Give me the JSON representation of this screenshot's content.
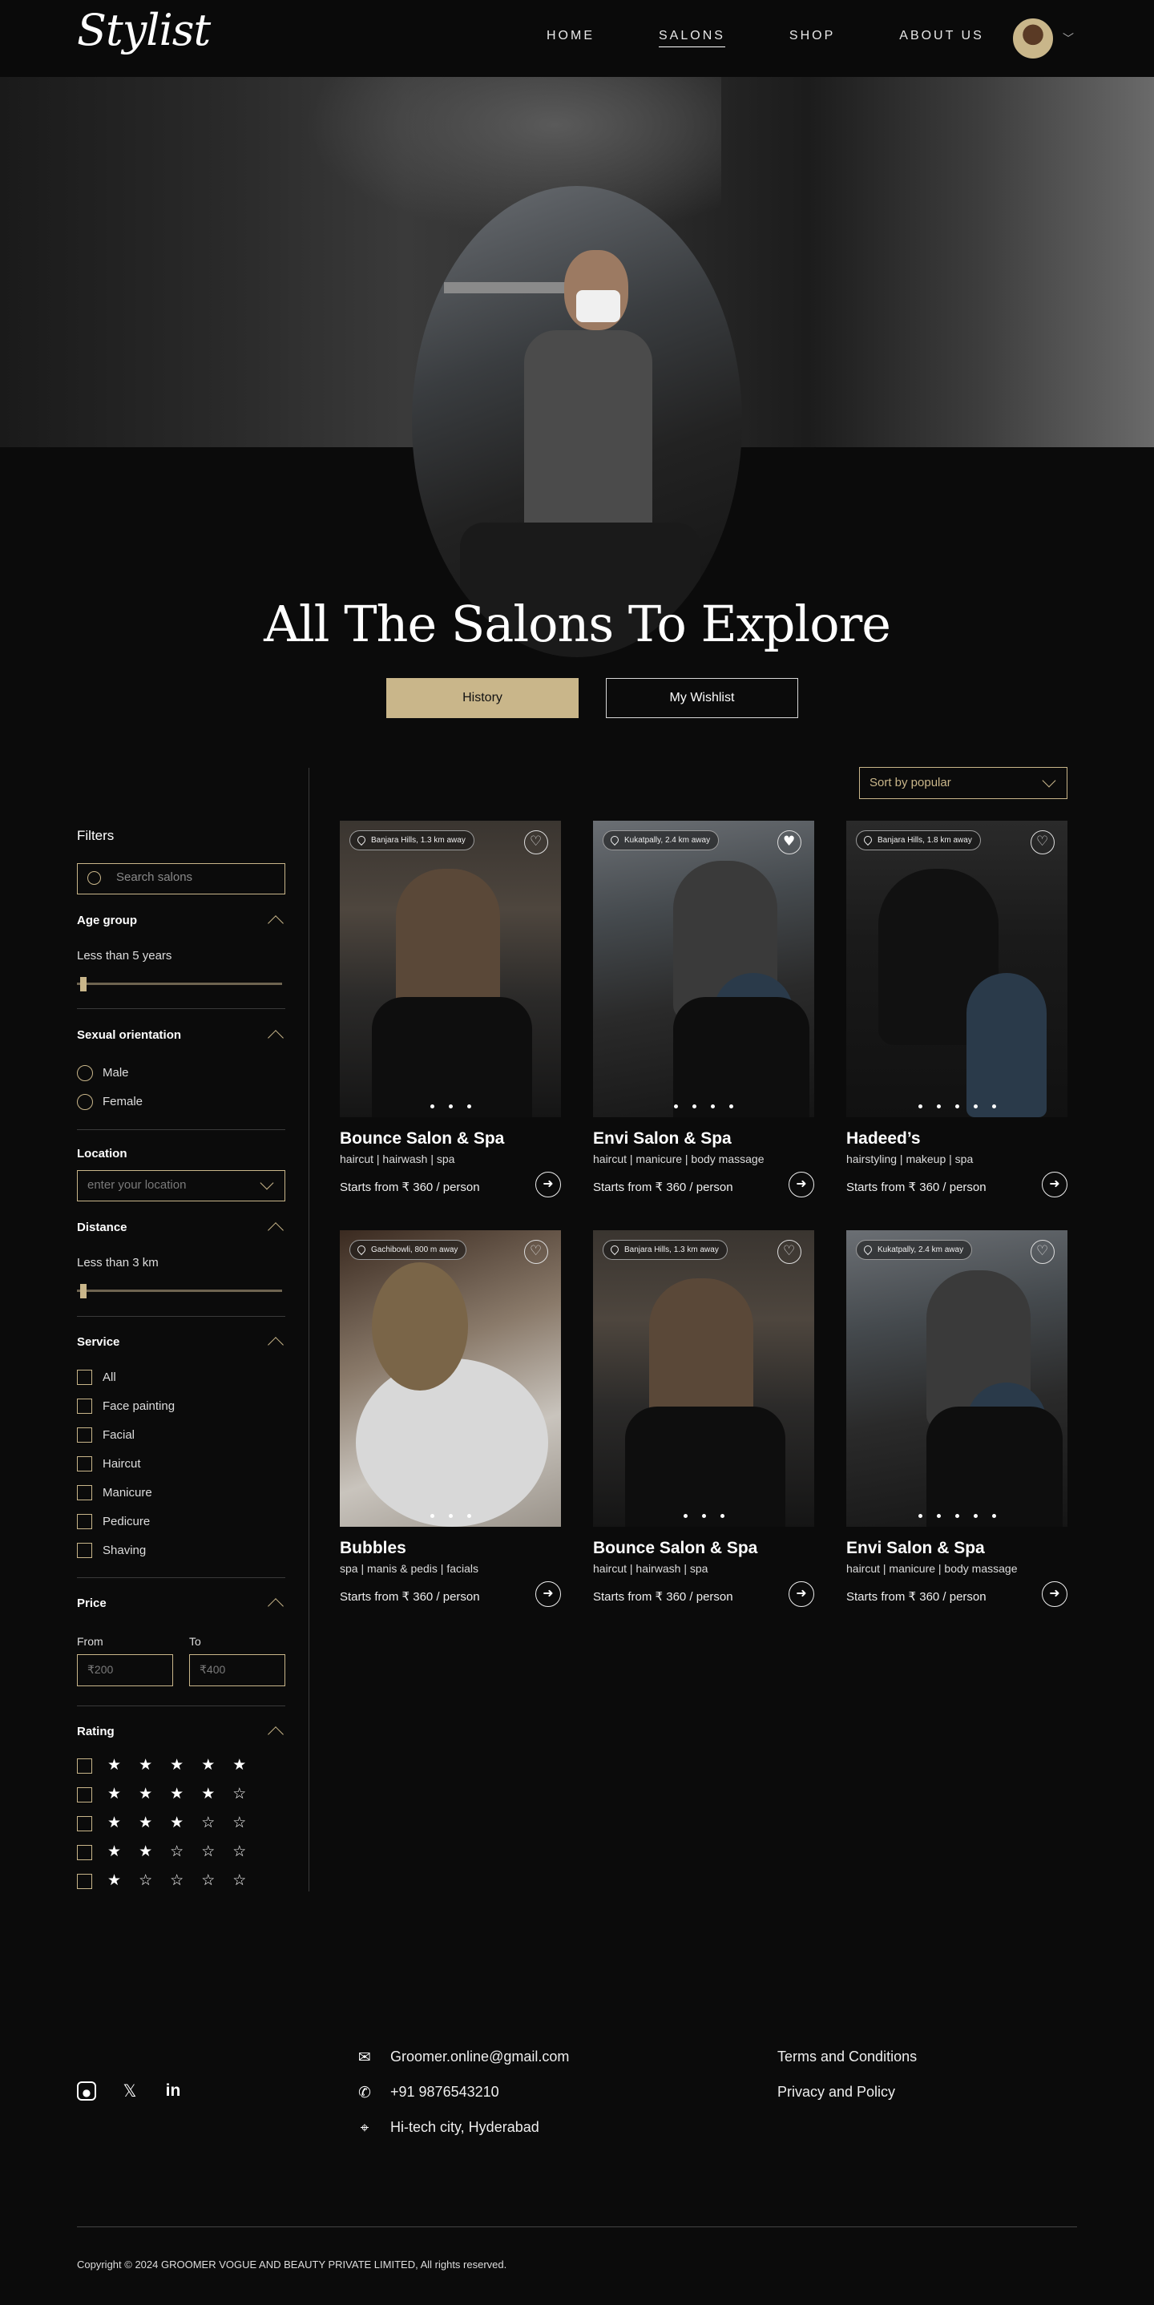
{
  "nav": {
    "logo": "Stylist",
    "links": [
      "HOME",
      "SALONS",
      "SHOP",
      "ABOUT US"
    ]
  },
  "hero": {
    "title": "All The Salons To Explore",
    "history_label": "History",
    "wishlist_label": "My Wishlist"
  },
  "filters": {
    "title": "Filters",
    "search_placeholder": "Search salons",
    "age_group": {
      "title": "Age group",
      "value_text": "Less than 5 years",
      "slider_fraction": 0.02
    },
    "sexual_orientation": {
      "title": "Sexual orientation",
      "options": [
        "Male",
        "Female"
      ]
    },
    "location": {
      "title": "Location",
      "placeholder": "enter your location"
    },
    "distance": {
      "title": "Distance",
      "value_text": "Less than 3 km",
      "slider_fraction": 0.02
    },
    "service": {
      "title": "Service",
      "options": [
        "All",
        "Face painting",
        "Facial",
        "Haircut",
        "Manicure",
        "Pedicure",
        "Shaving"
      ]
    },
    "price": {
      "title": "Price",
      "from_label": "From",
      "to_label": "To",
      "from_placeholder": "₹200",
      "to_placeholder": "₹400"
    },
    "rating": {
      "title": "Rating",
      "options": [
        "★ ★ ★ ★ ★",
        "★ ★ ★ ★ ☆",
        "★ ★ ★ ☆ ☆",
        "★ ★ ☆ ☆ ☆",
        "★ ☆ ☆ ☆ ☆"
      ]
    }
  },
  "sort": {
    "label": "Sort by popular"
  },
  "salons": [
    {
      "name": "Bounce Salon & Spa",
      "tags": "haircut | hairwash | spa",
      "price": "Starts from ₹ 360 / person",
      "location": "Banjara Hills, 1.3 km away",
      "favorite": false
    },
    {
      "name": "Envi Salon & Spa",
      "tags": "haircut | manicure | body massage",
      "price": "Starts from ₹ 360 / person",
      "location": "Kukatpally, 2.4 km away",
      "favorite": true
    },
    {
      "name": "Hadeed’s",
      "tags": "hairstyling | makeup | spa",
      "price": "Starts from ₹ 360 / person",
      "location": "Banjara Hills, 1.8 km away",
      "favorite": false
    },
    {
      "name": "Bubbles",
      "tags": "spa | manis & pedis | facials",
      "price": "Starts from ₹ 360 / person",
      "location": "Gachibowli, 800 m away",
      "favorite": false
    },
    {
      "name": "Bounce Salon & Spa",
      "tags": "haircut | hairwash | spa",
      "price": "Starts from ₹ 360 / person",
      "location": "Banjara Hills, 1.3 km away",
      "favorite": false
    },
    {
      "name": "Envi Salon & Spa",
      "tags": "haircut | manicure | body massage",
      "price": "Starts from ₹ 360 / person",
      "location": "Kukatpally, 2.4 km away",
      "favorite": false
    }
  ],
  "footer": {
    "email": "Groomer.online@gmail.com",
    "phone": "+91 9876543210",
    "address": "Hi-tech city, Hyderabad",
    "terms": "Terms and Conditions",
    "privacy": "Privacy and Policy",
    "copyright": "Copyright  ©  2024 GROOMER VOGUE AND BEAUTY PRIVATE LIMITED,  All rights reserved."
  }
}
